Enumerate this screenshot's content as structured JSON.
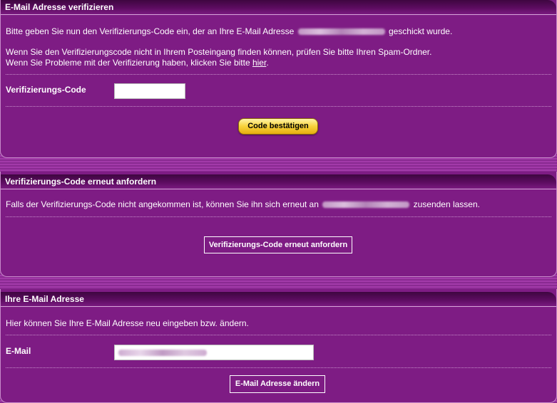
{
  "verify": {
    "title": "E-Mail Adresse verifizieren",
    "intro_before": "Bitte geben Sie nun den Verifizierungs-Code ein, der an Ihre E-Mail Adresse",
    "intro_after": "geschickt wurde.",
    "spam_hint": "Wenn Sie den Verifizierungscode nicht in Ihrem Posteingang finden können, prüfen Sie bitte Ihren Spam-Ordner.",
    "problem_before": "Wenn Sie Probleme mit der Verifizierung haben, klicken Sie bitte",
    "problem_link": "hier",
    "problem_after": ".",
    "code_label": "Verifizierungs-Code",
    "code_value": "",
    "confirm_button": "Code bestätigen"
  },
  "resend": {
    "title": "Verifizierungs-Code erneut anfordern",
    "text_before": "Falls der Verifizierungs-Code nicht angekommen ist, können Sie ihn sich erneut an",
    "text_after": "zusenden lassen.",
    "button": "Verifizierungs-Code erneut anfordern"
  },
  "email": {
    "title": "Ihre E-Mail Adresse",
    "text": "Hier können Sie Ihre E-Mail Adresse neu eingeben bzw. ändern.",
    "field_label": "E-Mail",
    "button": "E-Mail Adresse ändern"
  }
}
